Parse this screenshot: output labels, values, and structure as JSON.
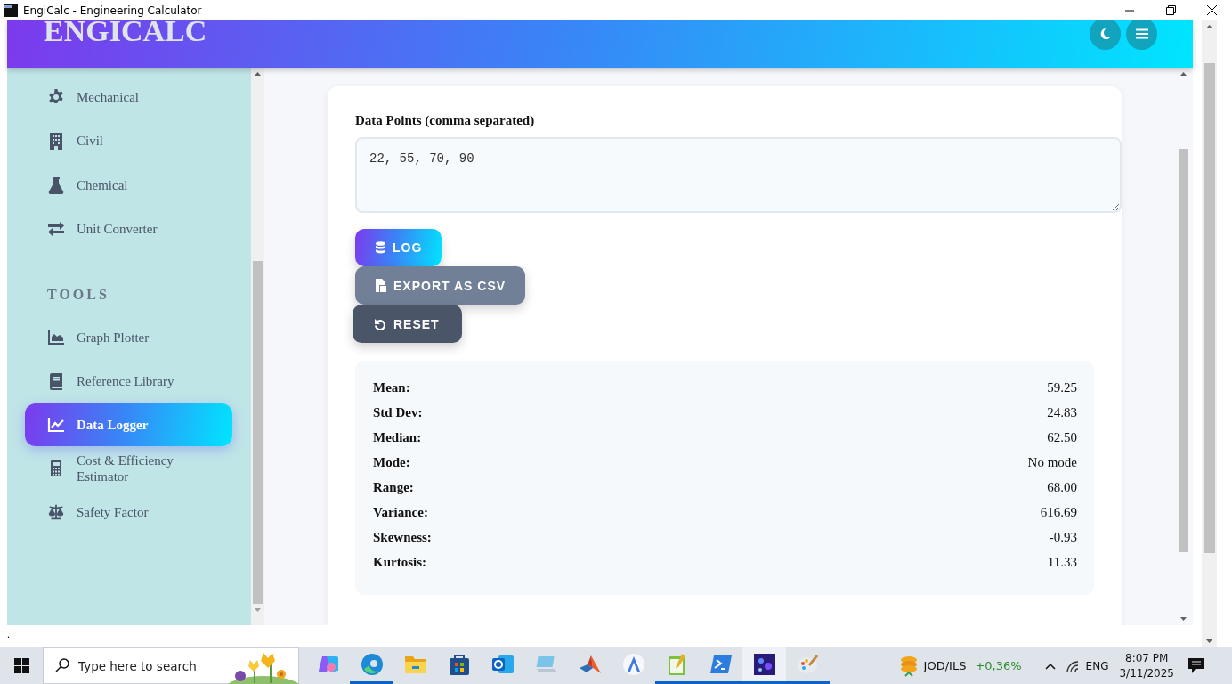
{
  "window": {
    "title": "EngiCalc - Engineering Calculator"
  },
  "header": {
    "logo": "ENGICALC"
  },
  "sidebar": {
    "groups": [
      {
        "items": [
          {
            "label": "Mechanical",
            "selected": false
          },
          {
            "label": "Civil",
            "selected": false
          },
          {
            "label": "Chemical",
            "selected": false
          },
          {
            "label": "Unit Converter",
            "selected": false
          }
        ]
      },
      {
        "heading": "TOOLS",
        "items": [
          {
            "label": "Graph Plotter",
            "selected": false
          },
          {
            "label": "Reference Library",
            "selected": false
          },
          {
            "label": "Data Logger",
            "selected": true
          },
          {
            "label": "Cost & Efficiency Estimator",
            "selected": false
          },
          {
            "label": "Safety Factor",
            "selected": false
          }
        ]
      }
    ]
  },
  "form": {
    "label": "Data Points (comma separated)",
    "value": "22, 55, 70, 90"
  },
  "buttons": [
    {
      "label": "LOG",
      "kind": "primary"
    },
    {
      "label": "EXPORT AS CSV",
      "kind": "secondary"
    },
    {
      "label": "RESET",
      "kind": "dark"
    }
  ],
  "stats": [
    {
      "label": "Mean:",
      "value": "59.25"
    },
    {
      "label": "Std Dev:",
      "value": "24.83"
    },
    {
      "label": "Median:",
      "value": "62.50"
    },
    {
      "label": "Mode:",
      "value": "No mode"
    },
    {
      "label": "Range:",
      "value": "68.00"
    },
    {
      "label": "Variance:",
      "value": "616.69"
    },
    {
      "label": "Skewness:",
      "value": "-0.93"
    },
    {
      "label": "Kurtosis:",
      "value": "11.33"
    }
  ],
  "footer_text": ".",
  "taskbar": {
    "search": {
      "placeholder": "Type here to search"
    },
    "apps": [
      {
        "running": false,
        "selected": false
      },
      {
        "running": true,
        "selected": false
      },
      {
        "running": false,
        "selected": false
      },
      {
        "running": false,
        "selected": false
      },
      {
        "running": false,
        "selected": false
      },
      {
        "running": false,
        "selected": false
      },
      {
        "running": false,
        "selected": false
      },
      {
        "running": false,
        "selected": false
      },
      {
        "running": true,
        "selected": false
      },
      {
        "running": true,
        "selected": false
      },
      {
        "running": true,
        "selected": true
      },
      {
        "running": true,
        "selected": false
      }
    ],
    "ticker": {
      "pair": "JOD/ILS",
      "change": "+0,36%"
    },
    "language": "ENG",
    "time": "8:07 PM",
    "date": "3/11/2025"
  }
}
